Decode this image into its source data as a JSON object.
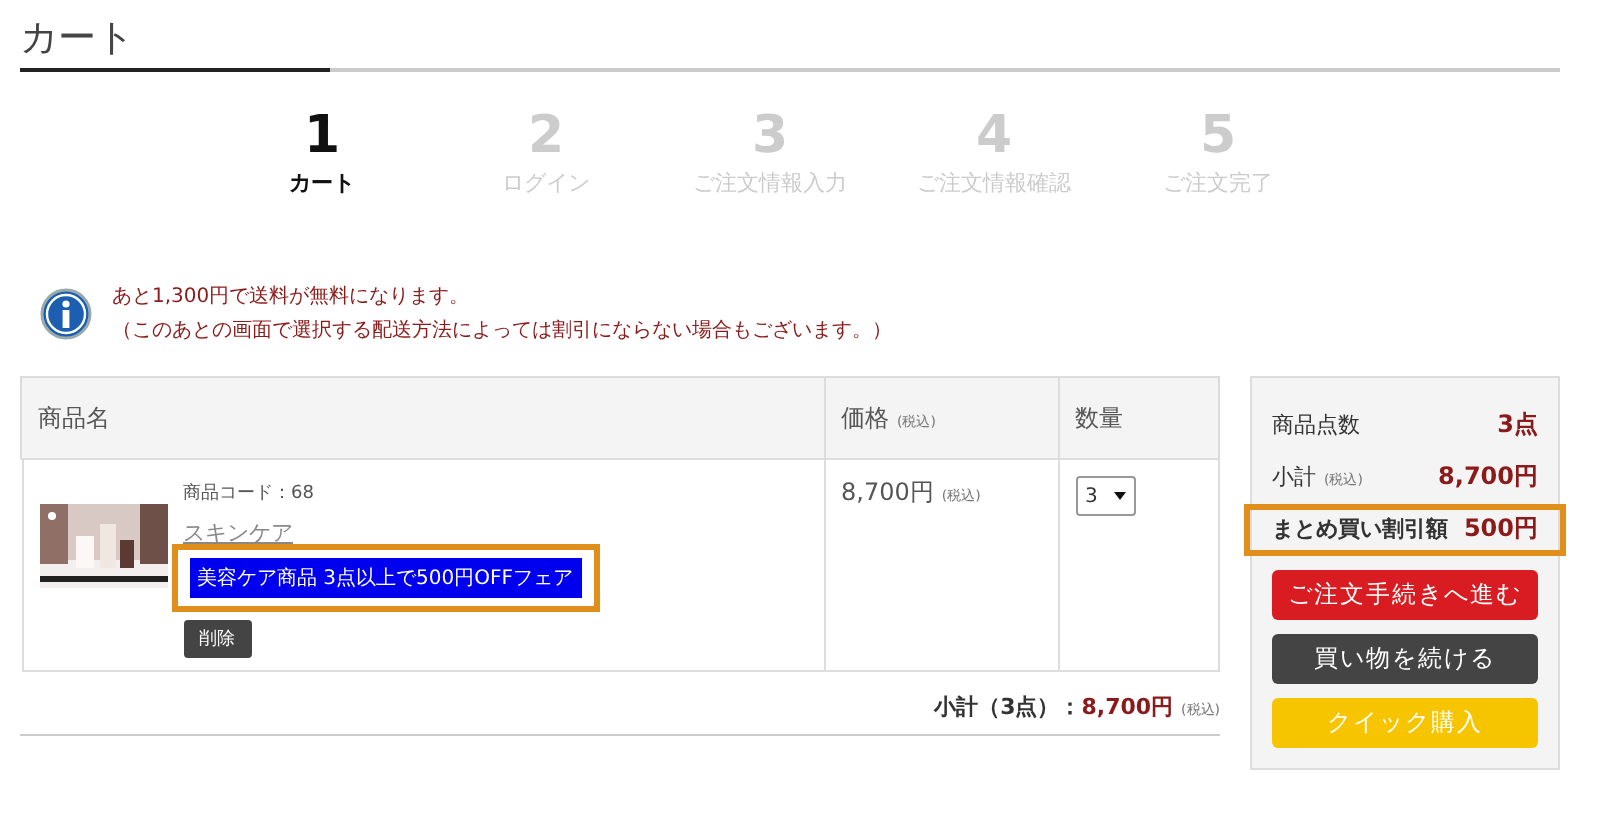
{
  "page_title": "カート",
  "steps": [
    {
      "number": "1",
      "label": "カート",
      "selected": true
    },
    {
      "number": "2",
      "label": "ログイン",
      "selected": false
    },
    {
      "number": "3",
      "label": "ご注文情報入力",
      "selected": false
    },
    {
      "number": "4",
      "label": "ご注文情報確認",
      "selected": false
    },
    {
      "number": "5",
      "label": "ご注文完了",
      "selected": false
    }
  ],
  "notice": {
    "lines": [
      "あと1,300円で送料が無料になります。",
      "（このあとの画面で選択する配送方法によっては割引にならない場合もございます。）"
    ]
  },
  "table": {
    "columns": [
      {
        "label": "商品名"
      },
      {
        "label": "価格",
        "note": "(税込)"
      },
      {
        "label": "数量"
      }
    ],
    "rows": [
      {
        "code": "商品コード：68",
        "name": "スキンケア",
        "promo": "美容ケア商品 3点以上で500円OFFフェア",
        "promo_highlighted": true,
        "delete": "削除",
        "price": "8,700円",
        "price_note": "(税込)",
        "quantity": "3"
      }
    ]
  },
  "subtotal": {
    "label": "小計（3点）：",
    "value": "8,700円",
    "note": "(税込)"
  },
  "summary": {
    "rows": [
      {
        "label": "商品点数",
        "value": "3点",
        "highlighted": false
      },
      {
        "label": "小計",
        "note": "(税込)",
        "value": "8,700円",
        "highlighted": false
      },
      {
        "label": "まとめ買い割引額",
        "value": "500円",
        "highlighted": true
      }
    ],
    "buttons": [
      {
        "label": "ご注文手続きへ進む",
        "kind": "primary"
      },
      {
        "label": "買い物を続ける",
        "kind": "dark"
      },
      {
        "label": "クイック購入",
        "kind": "quick"
      }
    ]
  }
}
